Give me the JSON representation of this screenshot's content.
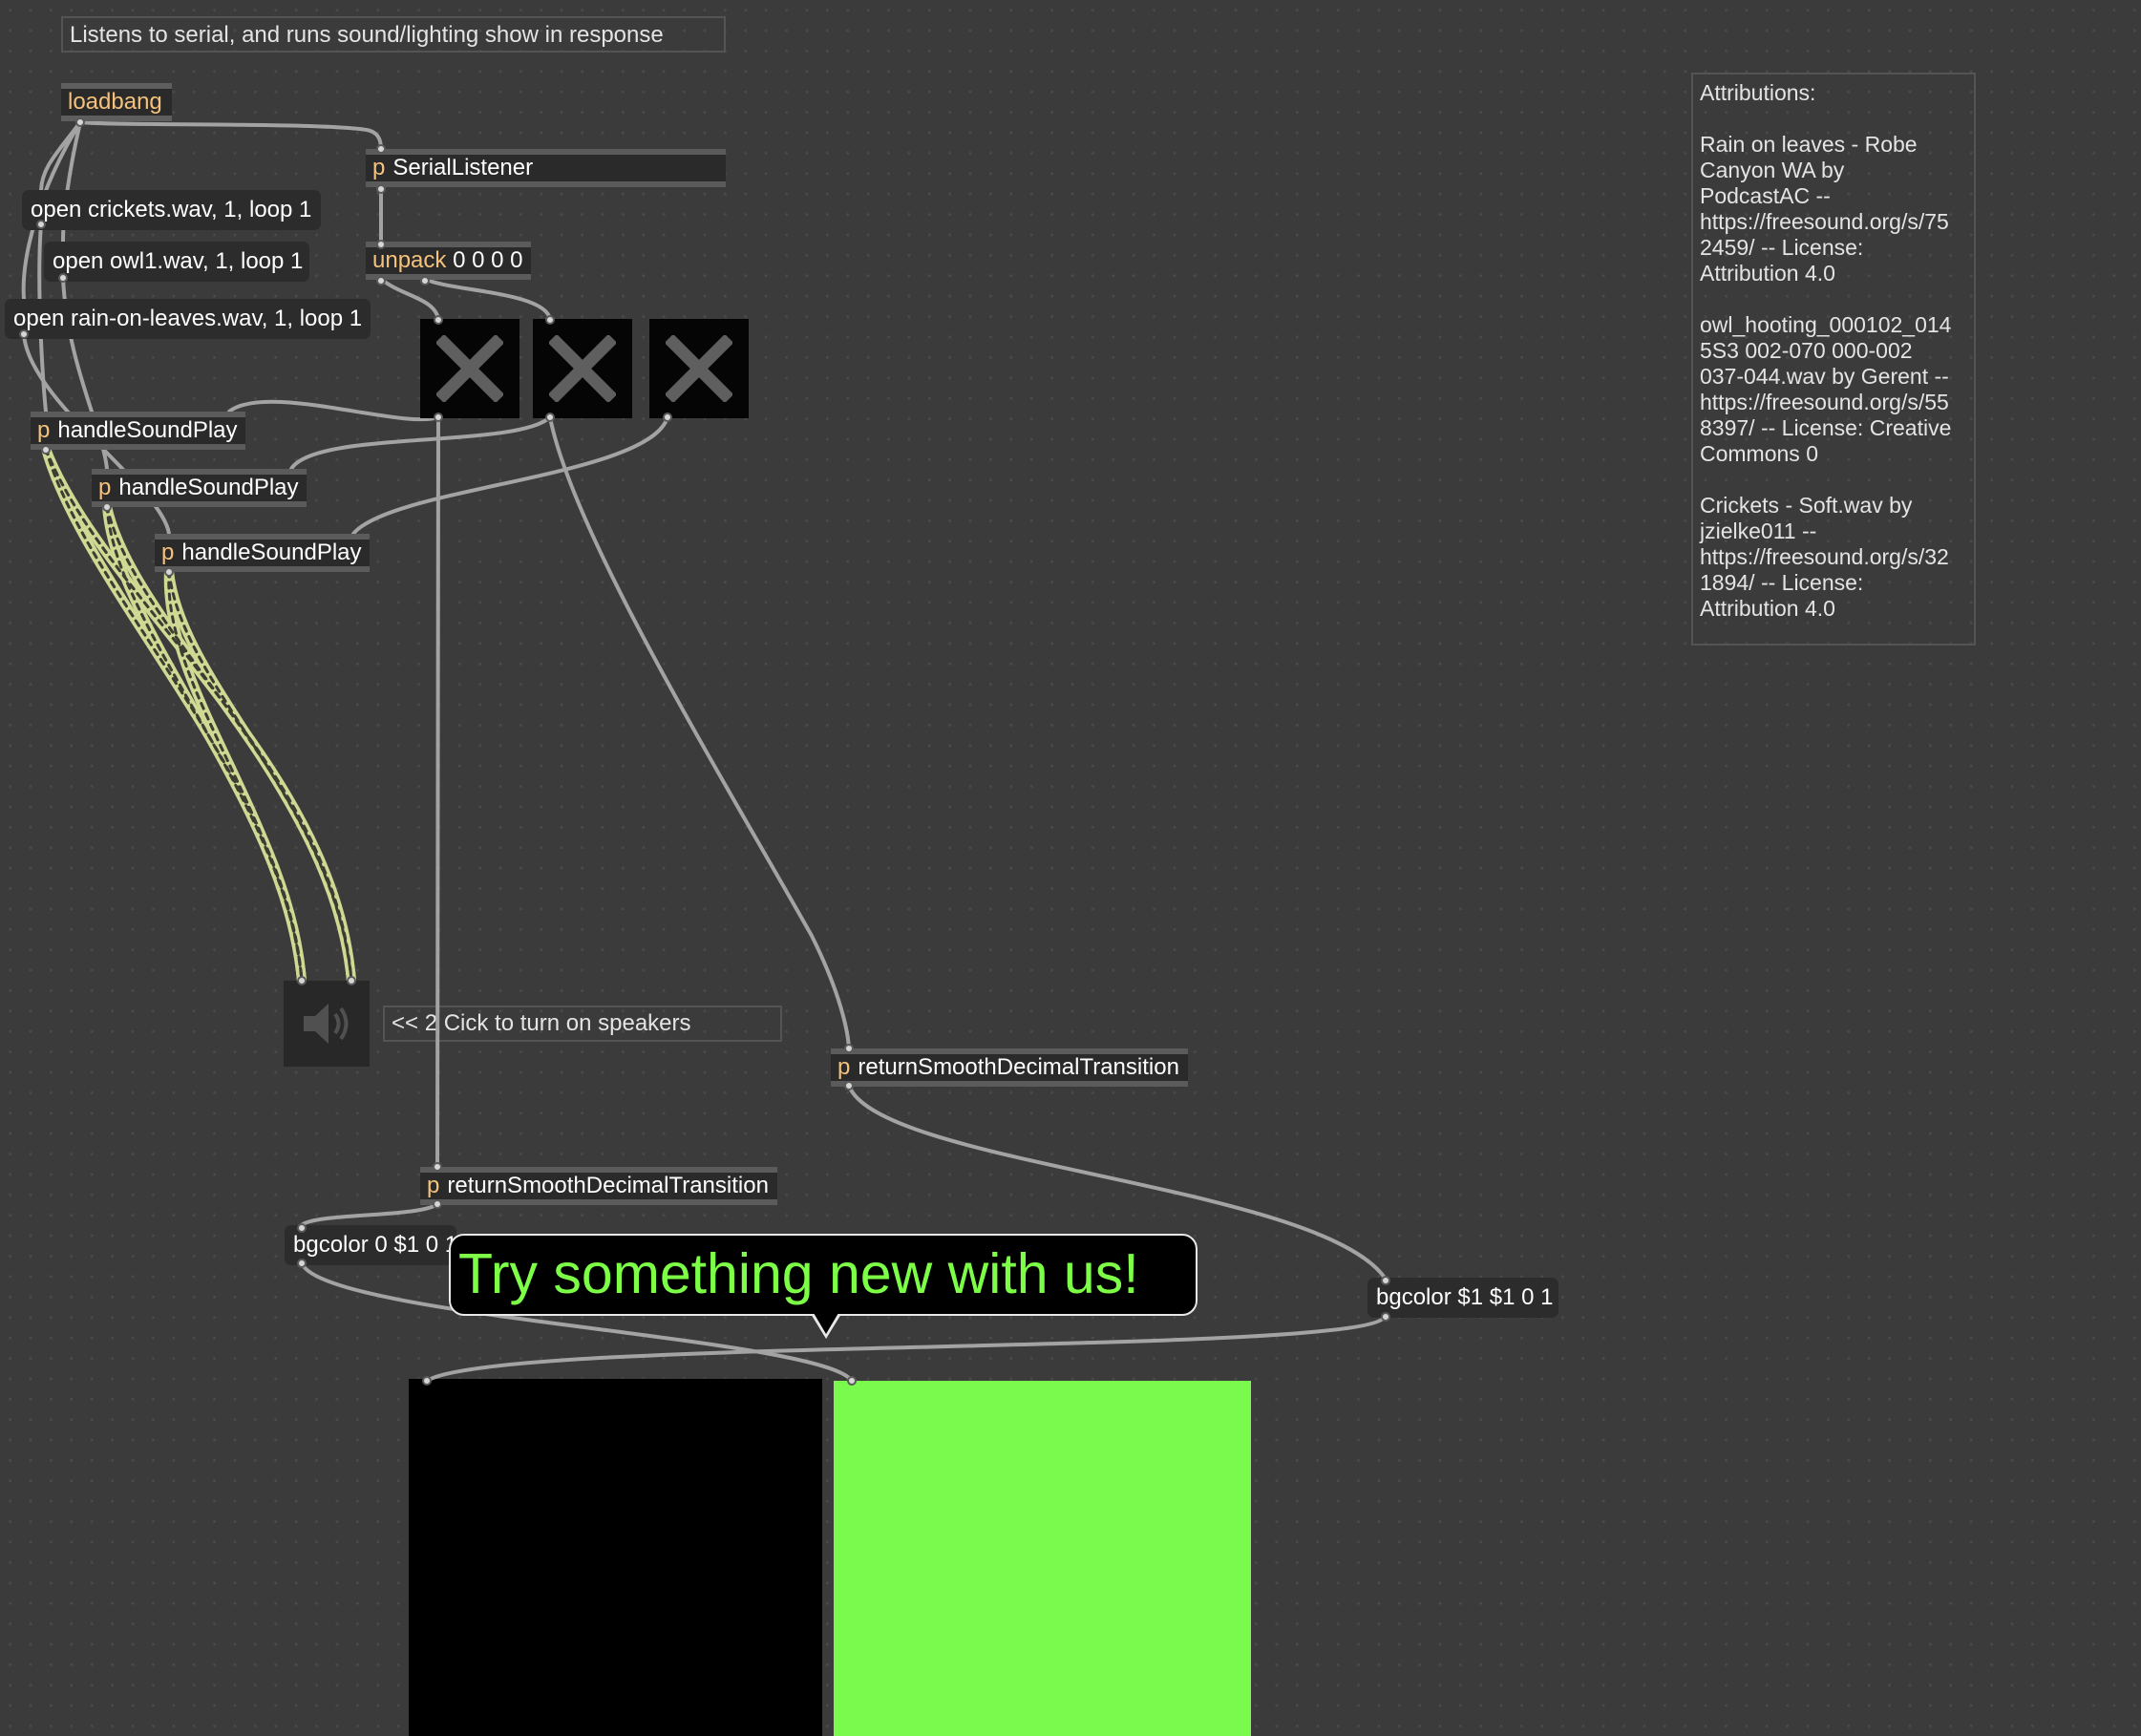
{
  "patch": {
    "description": "Listens to serial, and runs sound/lighting show in response",
    "attributions": "Attributions:\n\nRain on leaves - Robe\nCanyon WA by\nPodcastAC --\nhttps://freesound.org/s/75\n2459/ -- License:\nAttribution 4.0\n\nowl_hooting_000102_014\n5S3 002-070 000-002\n037-044.wav by Gerent --\nhttps://freesound.org/s/55\n8397/ -- License: Creative\nCommons 0\n\nCrickets - Soft.wav by\njzielke011 --\nhttps://freesound.org/s/32\n1894/ -- License:\nAttribution 4.0",
    "speaker_note": "<< 2  Cick to turn on speakers"
  },
  "objects": {
    "loadbang": "loadbang",
    "subpatch_prefix": "p",
    "serial_listener": "SerialListener",
    "unpack_keyword": "unpack",
    "unpack_args": "0 0 0 0",
    "handle_sound_play": "handleSoundPlay",
    "return_smooth": "returnSmoothDecimalTransition"
  },
  "messages": {
    "open_crickets": "open crickets.wav, 1, loop 1",
    "open_owl": "open owl1.wav, 1, loop 1",
    "open_rain": "open rain-on-leaves.wav, 1, loop 1",
    "bgcolor_left": "bgcolor 0 $1 0 1",
    "bgcolor_right": "bgcolor $1 $1 0 1"
  },
  "toggles": [
    {
      "state": "on"
    },
    {
      "state": "on"
    },
    {
      "state": "on"
    }
  ],
  "hint_bubble": "Try something new with us!",
  "colors": {
    "background": "#3b3b3b",
    "box": "#2a2a2a",
    "keyword": "#f4c27c",
    "patchcord": "#a3a3a3",
    "signal_cord": "#d9e59a",
    "panel_left": "#000000",
    "panel_right": "#79fa4c",
    "bubble_text": "#7cff46"
  }
}
